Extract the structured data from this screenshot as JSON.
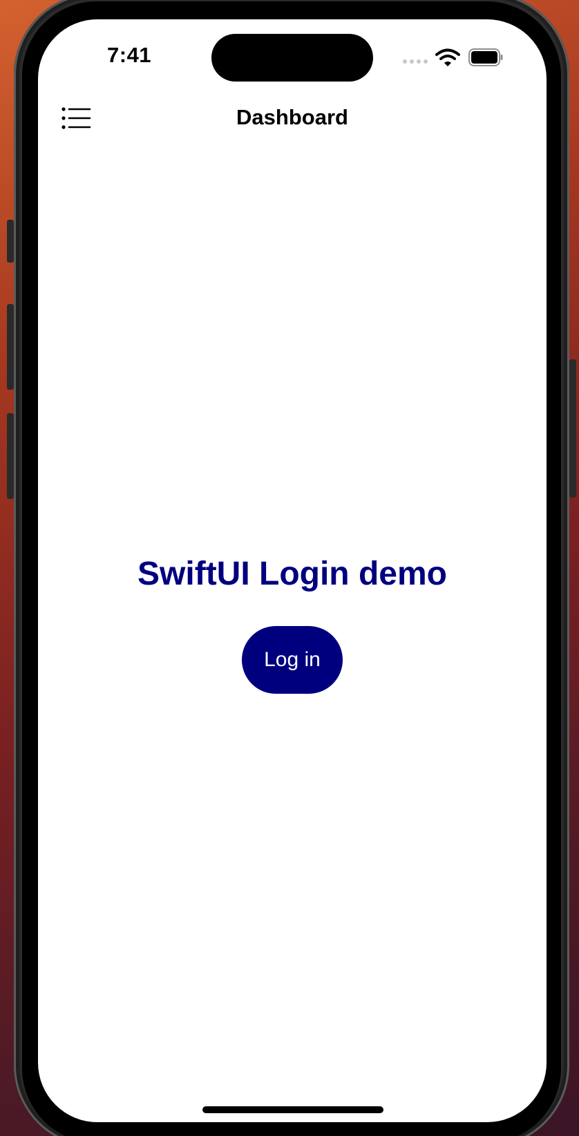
{
  "status_bar": {
    "time": "7:41",
    "icons": [
      "cellular-dots-icon",
      "wifi-icon",
      "battery-icon"
    ]
  },
  "nav_bar": {
    "title": "Dashboard",
    "menu_icon": "list-bullet-icon"
  },
  "main": {
    "title": "SwiftUI Login demo",
    "login_button_label": "Log in"
  },
  "colors": {
    "accent": "#00007f",
    "screen_background": "#ffffff",
    "nav_title": "#000000",
    "wallpaper_top": "#d4612f",
    "wallpaper_bottom": "#3a1526"
  }
}
